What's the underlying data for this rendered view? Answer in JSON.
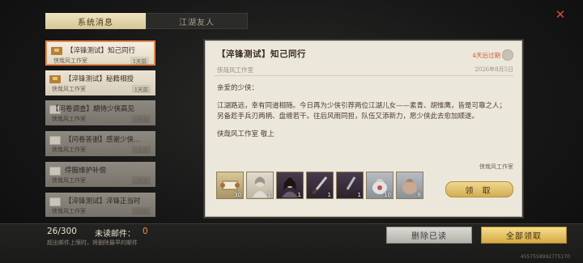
{
  "tabs": [
    {
      "label": "系统消息",
      "active": true
    },
    {
      "label": "江湖友人",
      "active": false
    }
  ],
  "mail_list": [
    {
      "title": "【淬锋测试】知己同行",
      "sender": "侠哉风工作室",
      "age": "1天前",
      "state": "selected"
    },
    {
      "title": "【淬锋测试】秘籍相授",
      "sender": "侠哉风工作室",
      "age": "1天前",
      "state": "unread"
    },
    {
      "title": "【问卷调查】期待少侠高见",
      "sender": "侠哉风工作室",
      "age": "1天前",
      "state": "read"
    },
    {
      "title": "【问卷答谢】感谢少侠…",
      "sender": "侠哉风工作室",
      "age": "1天前",
      "state": "read"
    },
    {
      "title": "停服维护补偿",
      "sender": "侠哉风工作室",
      "age": "1天前",
      "state": "read"
    },
    {
      "title": "【淬锋测试】淬锋正当时",
      "sender": "侠哉风工作室",
      "age": "2天前",
      "state": "read"
    }
  ],
  "detail": {
    "title": "【淬锋测试】知己同行",
    "expire": "4天后过期",
    "sender": "侠哉风工作室",
    "date": "2026年8月5日",
    "greeting": "亲爱的少侠：",
    "body": "江湖路远，幸有同道相随。今日再为少侠引荐两位江湖儿女——素青、胡惟鹰，皆是可靠之人；另备趁手兵刃两柄、盘缠若干。往后风雨同担，队伍又添新力，愿少侠此去愈加顺遂。",
    "closing": "侠哉风工作室 敬上",
    "signature": "侠哉风工作室",
    "claim_label": "领 取",
    "attachments": [
      {
        "icon": "scroll-icon",
        "count": "30"
      },
      {
        "icon": "character-portrait-icon",
        "count": "1"
      },
      {
        "icon": "character-portrait-icon",
        "count": "1"
      },
      {
        "icon": "blade-icon",
        "count": "1"
      },
      {
        "icon": "blade-icon",
        "count": "1"
      },
      {
        "icon": "pouch-icon",
        "count": "10"
      },
      {
        "icon": "pouch-icon",
        "count": "8"
      }
    ]
  },
  "footer": {
    "count": "26/300",
    "unread_label": "未读邮件：",
    "unread_value": "0",
    "note": "超出邮件上限时，将删除最早的邮件",
    "delete_read_label": "删除已读",
    "claim_all_label": "全部领取",
    "uid": "4557558992775170"
  }
}
